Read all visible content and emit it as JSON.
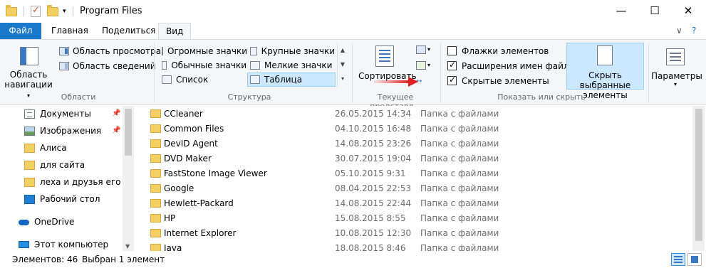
{
  "window": {
    "title": "Program Files",
    "controls": {
      "minimize": "—",
      "maximize": "☐",
      "close": "✕"
    }
  },
  "tabs": {
    "file": "Файл",
    "home": "Главная",
    "share": "Поделиться",
    "view": "Вид",
    "expand_icon": "∨",
    "help_icon": "?"
  },
  "ribbon": {
    "panes": {
      "nav_pane_line1": "Область",
      "nav_pane_line2": "навигации",
      "preview": "Область просмотра",
      "details": "Область сведений",
      "group_label": "Области"
    },
    "layout": {
      "items": [
        "Огромные значки",
        "Крупные значки",
        "Обычные значки",
        "Мелкие значки",
        "Список",
        "Таблица"
      ],
      "selected": "Таблица",
      "group_label": "Структура"
    },
    "current_view": {
      "sort": "Сортировать",
      "group_label": "Текущее представл..."
    },
    "show_hide": {
      "checkboxes": [
        {
          "label": "Флажки элементов",
          "checked": false
        },
        {
          "label": "Расширения имен файлов",
          "checked": true
        },
        {
          "label": "Скрытые элементы",
          "checked": true
        }
      ],
      "hide_selected_line1": "Скрыть выбранные",
      "hide_selected_line2": "элементы",
      "group_label": "Показать или скрыть"
    },
    "options": "Параметры"
  },
  "nav_items": [
    {
      "label": "Документы",
      "icon": "documents-icon",
      "pinned": true
    },
    {
      "label": "Изображения",
      "icon": "pictures-icon",
      "pinned": true
    },
    {
      "label": "Алиса",
      "icon": "folder-icon",
      "pinned": false
    },
    {
      "label": "для сайта",
      "icon": "folder-icon",
      "pinned": false
    },
    {
      "label": "леха и друзья его",
      "icon": "folder-icon",
      "pinned": false
    },
    {
      "label": "Рабочий стол",
      "icon": "desktop-icon",
      "pinned": false
    },
    {
      "label": "OneDrive",
      "icon": "onedrive-icon",
      "pinned": false
    },
    {
      "label": "Этот компьютер",
      "icon": "computer-icon",
      "pinned": false
    }
  ],
  "files": [
    {
      "name": "CCleaner",
      "date": "26.05.2015 14:34",
      "type": "Папка с файлами"
    },
    {
      "name": "Common Files",
      "date": "04.10.2015 16:48",
      "type": "Папка с файлами"
    },
    {
      "name": "DevID Agent",
      "date": "14.08.2015 23:26",
      "type": "Папка с файлами"
    },
    {
      "name": "DVD Maker",
      "date": "30.07.2015 19:04",
      "type": "Папка с файлами"
    },
    {
      "name": "FastStone Image Viewer",
      "date": "05.10.2015 9:31",
      "type": "Папка с файлами"
    },
    {
      "name": "Google",
      "date": "08.04.2015 22:53",
      "type": "Папка с файлами"
    },
    {
      "name": "Hewlett-Packard",
      "date": "14.08.2015 22:44",
      "type": "Папка с файлами"
    },
    {
      "name": "HP",
      "date": "15.08.2015 8:55",
      "type": "Папка с файлами"
    },
    {
      "name": "Internet Explorer",
      "date": "10.08.2015 12:30",
      "type": "Папка с файлами"
    },
    {
      "name": "Java",
      "date": "18.08.2015 8:46",
      "type": "Папка с файлами"
    }
  ],
  "status": {
    "count": "Элементов: 46",
    "selected": "Выбран 1 элемент"
  },
  "colors": {
    "accent": "#1979ca",
    "selection": "#cce8ff",
    "annotation_arrow": "#e02020"
  }
}
